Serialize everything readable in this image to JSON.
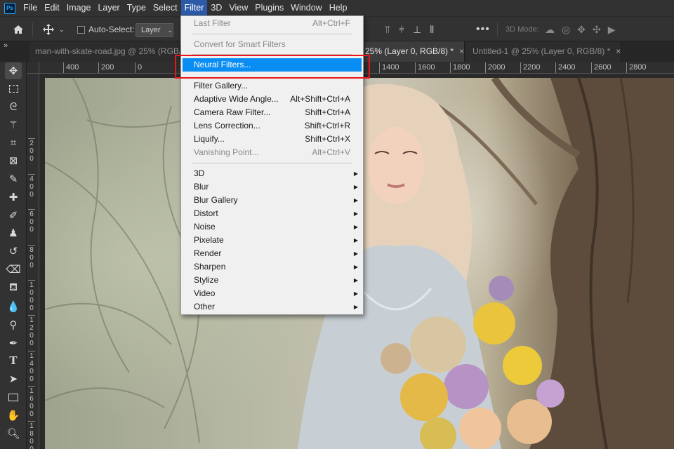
{
  "app": {
    "logo_text": "Ps"
  },
  "menubar": {
    "items": [
      "File",
      "Edit",
      "Image",
      "Layer",
      "Type",
      "Select",
      "Filter",
      "3D",
      "View",
      "Plugins",
      "Window",
      "Help"
    ],
    "active": "Filter"
  },
  "options_bar": {
    "auto_select_label": "Auto-Select:",
    "auto_select_checked": false,
    "layer_dropdown_value": "Layer",
    "more_label": "•••",
    "mode_3d_label": "3D Mode:"
  },
  "tabs": [
    {
      "label": "man-with-skate-road.jpg @ 25% (RGB/",
      "active": false
    },
    {
      "label": "25% (Layer 0, RGB/8) *",
      "active": true,
      "close": "×"
    },
    {
      "label": "Untitled-1 @ 25% (Layer 0, RGB/8) *",
      "active": false,
      "close": "×"
    }
  ],
  "collapse_label": "»",
  "ruler_h": [
    "400",
    "200",
    "0",
    "1400",
    "1600",
    "1800",
    "2000",
    "2200",
    "2400",
    "2600",
    "2800"
  ],
  "ruler_v": [
    "2\n0\n0",
    "4\n0\n0",
    "6\n0\n0",
    "8\n0\n0",
    "1\n0\n0\n0",
    "1\n2\n0\n0",
    "1\n4\n0\n0",
    "1\n6\n0\n0",
    "1\n8\n0\n0"
  ],
  "tools": [
    "move-icon",
    "marquee-icon",
    "lasso-icon",
    "magic-wand-icon",
    "crop-icon",
    "frame-icon",
    "eyedropper-icon",
    "healing-brush-icon",
    "brush-icon",
    "stamp-icon",
    "history-brush-icon",
    "eraser-icon",
    "paint-bucket-icon",
    "blur-icon",
    "dodge-icon",
    "pen-icon",
    "type-icon",
    "path-selection-icon",
    "rectangle-icon",
    "hand-icon",
    "zoom-icon"
  ],
  "filter_menu": {
    "items": [
      {
        "label": "Last Filter",
        "shortcut": "Alt+Ctrl+F",
        "disabled": true
      },
      {
        "sep": true
      },
      {
        "label": "Convert for Smart Filters",
        "disabled": false
      },
      {
        "sep": true
      },
      {
        "label": "Neural Filters...",
        "highlight": true
      },
      {
        "sep": true
      },
      {
        "label": "Filter Gallery..."
      },
      {
        "label": "Adaptive Wide Angle...",
        "shortcut": "Alt+Shift+Ctrl+A"
      },
      {
        "label": "Camera Raw Filter...",
        "shortcut": "Shift+Ctrl+A"
      },
      {
        "label": "Lens Correction...",
        "shortcut": "Shift+Ctrl+R"
      },
      {
        "label": "Liquify...",
        "shortcut": "Shift+Ctrl+X"
      },
      {
        "label": "Vanishing Point...",
        "shortcut": "Alt+Ctrl+V",
        "disabled": true
      },
      {
        "sep": true
      },
      {
        "label": "3D",
        "submenu": true
      },
      {
        "label": "Blur",
        "submenu": true
      },
      {
        "label": "Blur Gallery",
        "submenu": true
      },
      {
        "label": "Distort",
        "submenu": true
      },
      {
        "label": "Noise",
        "submenu": true
      },
      {
        "label": "Pixelate",
        "submenu": true
      },
      {
        "label": "Render",
        "submenu": true
      },
      {
        "label": "Sharpen",
        "submenu": true
      },
      {
        "label": "Stylize",
        "submenu": true
      },
      {
        "label": "Video",
        "submenu": true
      },
      {
        "label": "Other",
        "submenu": true
      }
    ]
  },
  "colors": {
    "menu_highlight": "#0a8df2",
    "annotation_box": "#e8161b",
    "active_menu": "#2d5aa8"
  }
}
